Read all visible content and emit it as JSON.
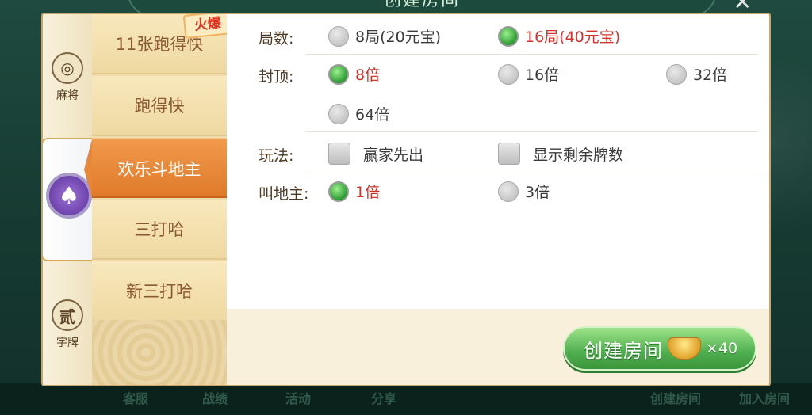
{
  "dialog": {
    "title": "创建房间",
    "close_icon": "close-icon"
  },
  "background": {
    "bottom_items": [
      "客服",
      "战绩",
      "活动",
      "分享",
      "创建房间",
      "加入房间"
    ]
  },
  "categories": [
    {
      "label": "麻将",
      "icon": "mahjong-coin-icon",
      "active": false
    },
    {
      "label": "",
      "icon": "spade-chip-icon",
      "active": true
    },
    {
      "label": "字牌",
      "icon": "zipai-coin-icon",
      "active": false
    }
  ],
  "games": [
    {
      "label": "11张跑得快",
      "badge": "火爆",
      "active": false
    },
    {
      "label": "跑得快",
      "active": false
    },
    {
      "label": "欢乐斗地主",
      "active": true
    },
    {
      "label": "三打哈",
      "active": false
    },
    {
      "label": "新三打哈",
      "active": false
    }
  ],
  "settings": {
    "rounds": {
      "label": "局数:",
      "options": [
        "8局(20元宝)",
        "16局(40元宝)"
      ],
      "selected": 1
    },
    "cap": {
      "label": "封顶:",
      "options": [
        "8倍",
        "16倍",
        "32倍",
        "64倍"
      ],
      "selected": 0
    },
    "rules": {
      "label": "玩法:",
      "options": [
        "赢家先出",
        "显示剩余牌数"
      ],
      "checked": [
        false,
        false
      ]
    },
    "bid": {
      "label": "叫地主:",
      "options": [
        "1倍",
        "3倍"
      ],
      "selected": 0
    }
  },
  "create_button": {
    "label": "创建房间",
    "icon": "gold-ingot-icon",
    "cost": "×40"
  },
  "colors": {
    "accent_orange": "#e8863a",
    "selected_text": "#d3332a",
    "button_green": "#4eae4e"
  }
}
